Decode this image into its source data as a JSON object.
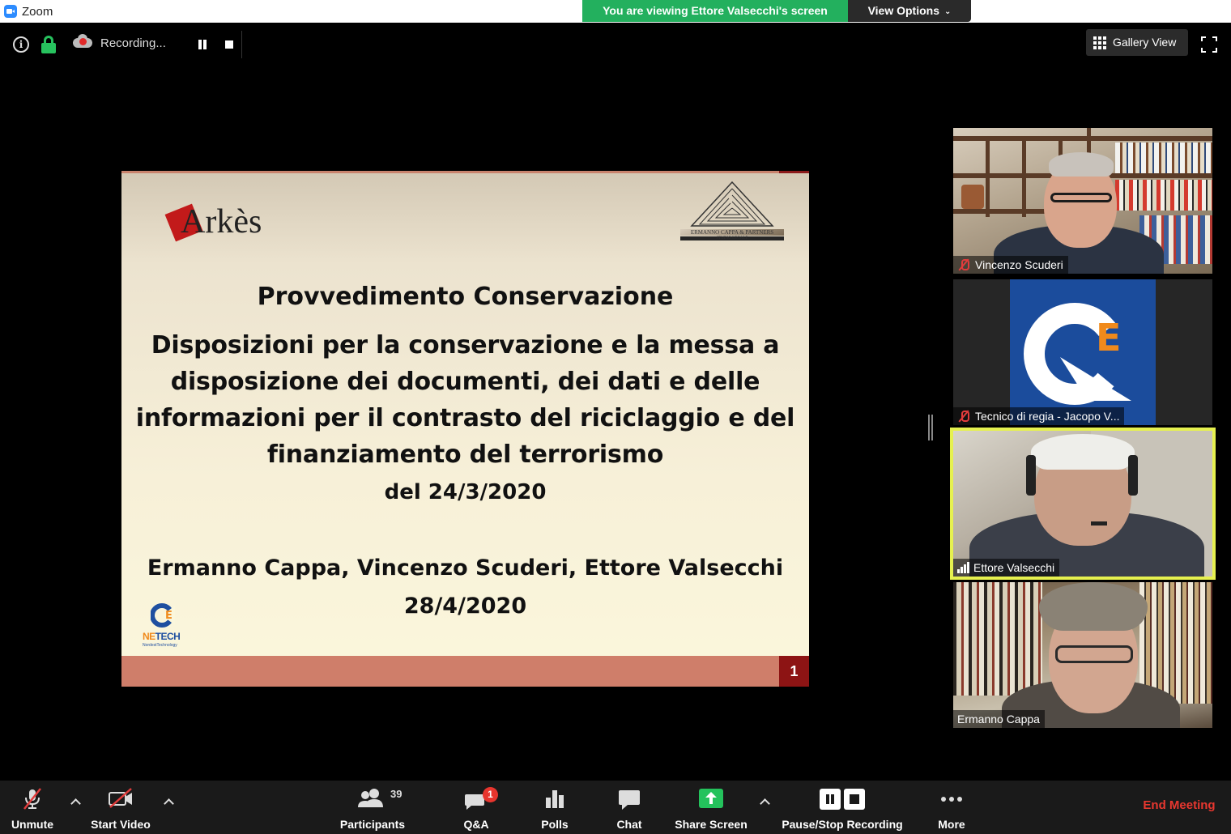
{
  "window": {
    "title": "Zoom"
  },
  "banner": {
    "viewing_text": "You are viewing Ettore Valsecchi's screen",
    "view_options_label": "View Options"
  },
  "topbar": {
    "recording_label": "Recording...",
    "gallery_label": "Gallery View"
  },
  "slide": {
    "logo_left": "Arkès",
    "logo_right_line1": "ERMANNO CAPPA & PARTNERS",
    "logo_right_line2": "STUDIO LEGALE",
    "title": "Provvedimento Conservazione",
    "subtitle_lines": [
      "Disposizioni per la conservazione e la messa a",
      "disposizione dei documenti, dei dati e delle",
      "informazioni per il contrasto del riciclaggio e del",
      "finanziamento del terrorismo"
    ],
    "date": "del 24/3/2020",
    "authors": "Ermanno Cappa, Vincenzo Scuderi, Ettore Valsecchi",
    "presentation_date": "28/4/2020",
    "netech_word_1": "NE",
    "netech_word_2": "TECH",
    "netech_tagline": "NordestTechnology",
    "page_number": "1"
  },
  "participants_panel": [
    {
      "name": "Vincenzo Scuderi",
      "muted": true
    },
    {
      "name": "Tecnico di regia - Jacopo V...",
      "muted": true
    },
    {
      "name": "Ettore Valsecchi",
      "muted": false,
      "active_speaker": true
    },
    {
      "name": "Ermanno Cappa",
      "muted": false
    }
  ],
  "toolbar": {
    "unmute": "Unmute",
    "start_video": "Start Video",
    "participants": "Participants",
    "participants_count": "39",
    "qa": "Q&A",
    "qa_badge": "1",
    "polls": "Polls",
    "chat": "Chat",
    "share_screen": "Share Screen",
    "pause_stop_recording": "Pause/Stop Recording",
    "more": "More",
    "end_meeting": "End Meeting"
  },
  "colors": {
    "banner_green": "#23b05e",
    "end_meeting_red": "#e8372f",
    "active_speaker_outline": "#e6f14f",
    "share_green": "#24c25c",
    "muted_red": "#e23c3c"
  }
}
